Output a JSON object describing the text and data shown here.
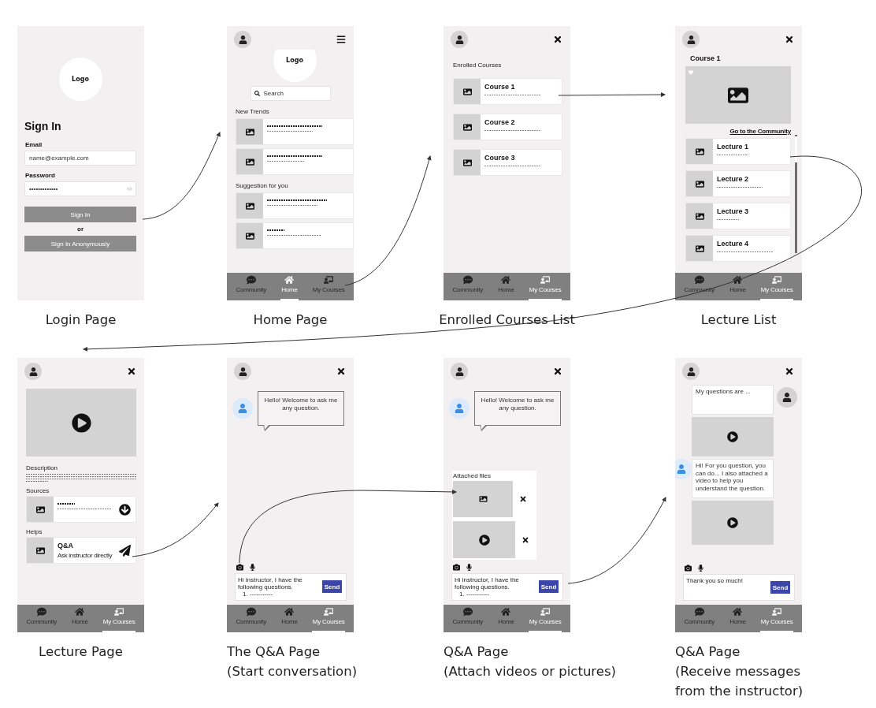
{
  "screens": [
    {
      "kind": "login",
      "caption": [
        "Login Page"
      ],
      "logo": "Logo",
      "heading": "Sign In",
      "fields": [
        {
          "kind": "text",
          "label": "Email",
          "value": "name@example.com"
        },
        {
          "kind": "password",
          "label": "Password",
          "value": "•••••••••••••"
        }
      ],
      "primary_button": "Sign In",
      "separator": "or",
      "secondary_button": "Sign In Anonymously"
    },
    {
      "kind": "home",
      "caption": [
        "Home Page"
      ],
      "menu_button": true,
      "logo": "Logo",
      "search": {
        "placeholder": "Search"
      },
      "sections": [
        {
          "title": "New Trends",
          "cards": [
            {
              "kind": "placeholder"
            },
            {
              "kind": "placeholder"
            }
          ]
        },
        {
          "title": "Suggestion for you",
          "cards": [
            {
              "kind": "placeholder"
            },
            {
              "kind": "placeholder"
            }
          ]
        }
      ],
      "nav": [
        {
          "label": "Community",
          "selected": false
        },
        {
          "label": "Home",
          "selected": true
        },
        {
          "label": "My Courses",
          "selected": false
        }
      ]
    },
    {
      "kind": "courses",
      "caption": [
        "Enrolled Courses List"
      ],
      "menu_button": false,
      "title": "Enrolled Courses",
      "cards": [
        {
          "kind": "titled",
          "title": "Course 1"
        },
        {
          "kind": "titled",
          "title": "Course 2"
        },
        {
          "kind": "titled",
          "title": "Course 3"
        }
      ],
      "nav": [
        {
          "label": "Community",
          "selected": false
        },
        {
          "label": "Home",
          "selected": false
        },
        {
          "label": "My Courses",
          "selected": true
        }
      ]
    },
    {
      "kind": "lectures",
      "caption": [
        "Lecture List"
      ],
      "menu_button": false,
      "title": "Course 1",
      "link": "Go to the Community",
      "cards": [
        {
          "kind": "titled",
          "title": "Lecture 1"
        },
        {
          "kind": "titled",
          "title": "Lecture 2"
        },
        {
          "kind": "titled",
          "title": "Lecture 3"
        },
        {
          "kind": "titled",
          "title": "Lecture 4"
        }
      ],
      "nav": [
        {
          "label": "Community",
          "selected": false
        },
        {
          "label": "Home",
          "selected": false
        },
        {
          "label": "My Courses",
          "selected": true
        }
      ]
    },
    {
      "kind": "lecture",
      "caption": [
        "Lecture Page"
      ],
      "menu_button": false,
      "description": {
        "title": "Description"
      },
      "sections": [
        {
          "title": "Sources",
          "cards": [
            {
              "kind": "placeholder"
            }
          ]
        },
        {
          "title": "Helps",
          "cards": [
            {
              "kind": "titled",
              "title": "Q&A",
              "subtitle": "Ask instructor directly"
            }
          ]
        }
      ],
      "nav": [
        {
          "label": "Community",
          "selected": false
        },
        {
          "label": "Home",
          "selected": false
        },
        {
          "label": "My Courses",
          "selected": true
        }
      ]
    },
    {
      "kind": "qa",
      "caption": [
        "The Q&A Page",
        "(Start conversation)"
      ],
      "menu_button": false,
      "messages": [
        {
          "kind": "welcome",
          "text": "Hello! Welcome to ask me any question."
        }
      ],
      "composer": {
        "value": "Hi instructor, I have the following questions.",
        "list_item": "1. -----------",
        "button": "Send"
      },
      "nav": [
        {
          "label": "Community",
          "selected": false
        },
        {
          "label": "Home",
          "selected": false
        },
        {
          "label": "My Courses",
          "selected": true
        }
      ]
    },
    {
      "kind": "qa",
      "caption": [
        "Q&A Page",
        "(Attach videos or pictures)"
      ],
      "menu_button": false,
      "messages": [
        {
          "kind": "welcome",
          "text": "Hello! Welcome to ask me any question."
        }
      ],
      "attachments": {
        "title": "Attached files",
        "items": [
          {
            "kind": "image"
          },
          {
            "kind": "video"
          }
        ]
      },
      "composer": {
        "value": "Hi instructor, I have the following questions.",
        "list_item": "1. -----------",
        "button": "Send"
      },
      "nav": [
        {
          "label": "Community",
          "selected": false
        },
        {
          "label": "Home",
          "selected": false
        },
        {
          "label": "My Courses",
          "selected": true
        }
      ]
    },
    {
      "kind": "qa",
      "caption": [
        "Q&A Page",
        "(Receive messages",
        "from the instructor)"
      ],
      "menu_button": false,
      "messages": [
        {
          "kind": "text",
          "from_instructor": false,
          "text": "My questions are ..."
        },
        {
          "kind": "video",
          "from_instructor": false
        },
        {
          "kind": "text",
          "from_instructor": true,
          "text": "Hi! For you question, you can do... I also attached a video to help you understand the question."
        },
        {
          "kind": "video",
          "from_instructor": true
        }
      ],
      "composer": {
        "value": "Thank you so much!",
        "button": "Send"
      },
      "nav": [
        {
          "label": "Community",
          "selected": false
        },
        {
          "label": "Home",
          "selected": false
        },
        {
          "label": "My Courses",
          "selected": true
        }
      ]
    }
  ]
}
